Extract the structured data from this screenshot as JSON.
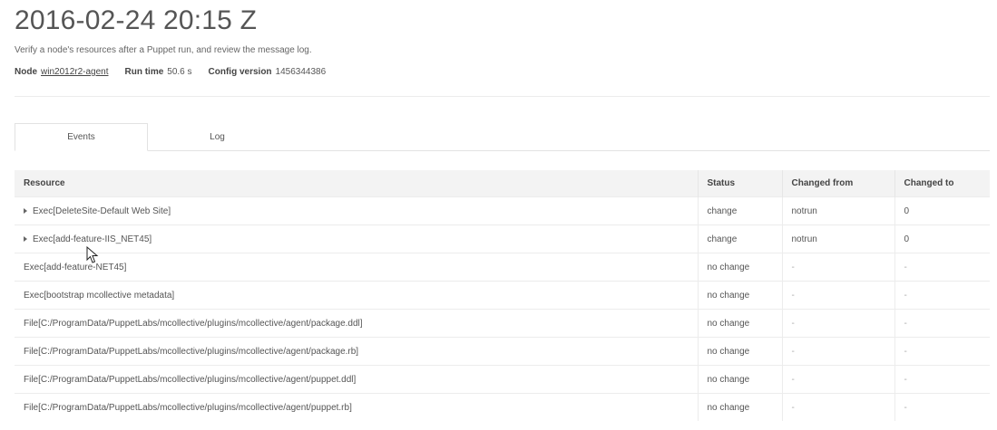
{
  "report": {
    "title": "2016-02-24 20:15 Z",
    "subtitle": "Verify a node's resources after a Puppet run, and review the message log.",
    "node_label": "Node",
    "node_value": "win2012r2-agent",
    "runtime_label": "Run time",
    "runtime_value": "50.6 s",
    "config_label": "Config version",
    "config_value": "1456344386"
  },
  "tabs": [
    {
      "label": "Events",
      "active": true
    },
    {
      "label": "Log",
      "active": false
    }
  ],
  "table": {
    "headers": [
      "Resource",
      "Status",
      "Changed from",
      "Changed to"
    ],
    "rows": [
      {
        "resource": "Exec[DeleteSite-Default Web Site]",
        "status": "change",
        "from": "notrun",
        "to": "0",
        "expandable": true
      },
      {
        "resource": "Exec[add-feature-IIS_NET45]",
        "status": "change",
        "from": "notrun",
        "to": "0",
        "expandable": true
      },
      {
        "resource": "Exec[add-feature-NET45]",
        "status": "no change",
        "from": "-",
        "to": "-",
        "expandable": false
      },
      {
        "resource": "Exec[bootstrap mcollective metadata]",
        "status": "no change",
        "from": "-",
        "to": "-",
        "expandable": false
      },
      {
        "resource": "File[C:/ProgramData/PuppetLabs/mcollective/plugins/mcollective/agent/package.ddl]",
        "status": "no change",
        "from": "-",
        "to": "-",
        "expandable": false
      },
      {
        "resource": "File[C:/ProgramData/PuppetLabs/mcollective/plugins/mcollective/agent/package.rb]",
        "status": "no change",
        "from": "-",
        "to": "-",
        "expandable": false
      },
      {
        "resource": "File[C:/ProgramData/PuppetLabs/mcollective/plugins/mcollective/agent/puppet.ddl]",
        "status": "no change",
        "from": "-",
        "to": "-",
        "expandable": false
      },
      {
        "resource": "File[C:/ProgramData/PuppetLabs/mcollective/plugins/mcollective/agent/puppet.rb]",
        "status": "no change",
        "from": "-",
        "to": "-",
        "expandable": false
      }
    ]
  }
}
